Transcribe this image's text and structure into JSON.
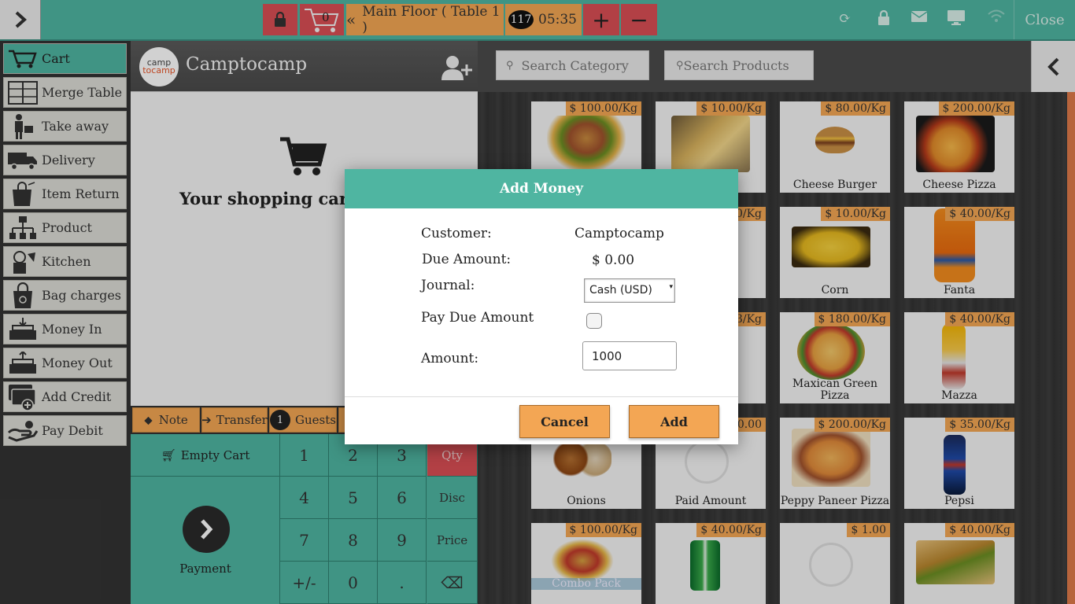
{
  "topbar": {
    "cart_count": "0",
    "floor_label": "Main Floor ( Table 1 )",
    "order_number": "117",
    "time": "05:35",
    "plus": "+",
    "minus": "−",
    "close_label": "Close"
  },
  "sidebar": {
    "items": [
      {
        "label": "Cart",
        "icon": "cart-icon"
      },
      {
        "label": "Merge Table",
        "icon": "merge-table-icon"
      },
      {
        "label": "Take away",
        "icon": "take-away-icon"
      },
      {
        "label": "Delivery",
        "icon": "delivery-truck-icon"
      },
      {
        "label": "Item Return",
        "icon": "item-return-icon"
      },
      {
        "label": "Product",
        "icon": "product-icon"
      },
      {
        "label": "Kitchen",
        "icon": "kitchen-icon"
      },
      {
        "label": "Bag charges",
        "icon": "bag-icon"
      },
      {
        "label": "Money In",
        "icon": "money-in-icon"
      },
      {
        "label": "Money Out",
        "icon": "money-out-icon"
      },
      {
        "label": "Add Credit",
        "icon": "add-credit-icon"
      },
      {
        "label": "Pay Debit",
        "icon": "pay-debit-icon"
      }
    ]
  },
  "cart": {
    "customer_name": "Camptocamp",
    "logo_top": "camp",
    "logo_bottom": "tocamp",
    "empty_text": "Your shopping cart is empty",
    "actions": {
      "note": "Note",
      "transfer": "Transfer",
      "guests_count": "1",
      "guests": "Guests"
    },
    "numpad": {
      "empty_cart": "Empty Cart",
      "payment": "Payment",
      "keys": [
        "1",
        "2",
        "3",
        "Qty",
        "4",
        "5",
        "6",
        "Disc",
        "7",
        "8",
        "9",
        "Price",
        "+/-",
        "0",
        ".",
        "⌫"
      ]
    }
  },
  "products": {
    "search_category_placeholder": "Search Category",
    "search_products_placeholder": "Search Products",
    "items": [
      {
        "name": "",
        "price": "$ 100.00/Kg"
      },
      {
        "name": "",
        "price": "$ 10.00/Kg"
      },
      {
        "name": "Cheese Burger",
        "price": "$ 80.00/Kg"
      },
      {
        "name": "Cheese Pizza",
        "price": "$ 200.00/Kg"
      },
      {
        "name": "",
        "price": "0/Kg"
      },
      {
        "name": "Corn",
        "price": "$ 10.00/Kg"
      },
      {
        "name": "Fanta",
        "price": "$ 40.00/Kg"
      },
      {
        "name": "",
        "price": "3/Kg"
      },
      {
        "name": "Maxican Green Pizza",
        "price": "$ 180.00/Kg"
      },
      {
        "name": "Mazza",
        "price": "$ 40.00/Kg"
      },
      {
        "name": "Onions",
        "price": ""
      },
      {
        "name": "Paid Amount",
        "price": "0.00"
      },
      {
        "name": "Peppy Paneer Pizza",
        "price": "$ 200.00/Kg"
      },
      {
        "name": "Pepsi",
        "price": "$ 35.00/Kg"
      },
      {
        "name": "Combo Pack",
        "price": "$ 100.00/Kg"
      },
      {
        "name": "",
        "price": "$ 40.00/Kg"
      },
      {
        "name": "",
        "price": "$ 1.00"
      },
      {
        "name": "",
        "price": "$ 40.00/Kg"
      }
    ]
  },
  "modal": {
    "title": "Add Money",
    "customer_label": "Customer:",
    "customer_value": "Camptocamp",
    "due_label": "Due Amount:",
    "due_value": "$ 0.00",
    "journal_label": "Journal:",
    "journal_value": "Cash (USD)",
    "pay_due_label": "Pay Due Amount",
    "pay_due_checked": false,
    "amount_label": "Amount:",
    "amount_value": "1000",
    "cancel_label": "Cancel",
    "add_label": "Add"
  },
  "colors": {
    "accent": "#4fb5a1",
    "orange": "#f3a654",
    "red": "#d94f55"
  }
}
